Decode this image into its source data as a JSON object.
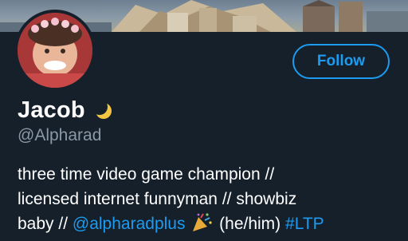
{
  "profile": {
    "display_name": "Jacob",
    "name_emoji_icon": "crescent-moon-icon",
    "handle": "@Alpharad",
    "follow_label": "Follow",
    "bio": {
      "line1": "three time video game champion //",
      "line2": "licensed internet funnyman // showbiz",
      "line3_prefix": "baby // ",
      "mention": "@alpharadplus",
      "emoji_icon": "party-popper-icon",
      "pronouns": "(he/him)",
      "hashtag": "#LTP"
    }
  },
  "colors": {
    "background": "#15202b",
    "accent": "#1d9bf0",
    "secondary_text": "#8b98a5",
    "primary_text": "#ffffff"
  }
}
